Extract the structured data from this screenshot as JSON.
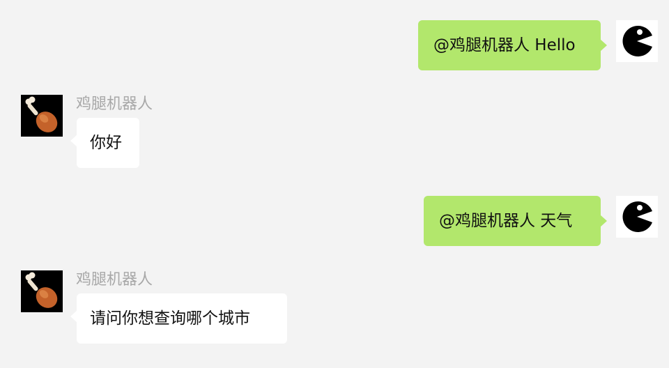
{
  "messages": [
    {
      "direction": "out",
      "text": "@鸡腿机器人 Hello"
    },
    {
      "direction": "in",
      "sender": "鸡腿机器人",
      "text": "你好"
    },
    {
      "direction": "out",
      "text": "@鸡腿机器人 天气"
    },
    {
      "direction": "in",
      "sender": "鸡腿机器人",
      "text": "请问你想查询哪个城市"
    }
  ],
  "icons": {
    "self_avatar": "pacman-icon",
    "bot_avatar": "chicken-drumstick-icon"
  },
  "colors": {
    "background": "#f3f3f3",
    "outgoing_bubble": "#b2e76c",
    "incoming_bubble": "#ffffff",
    "sender_name": "#a8a8a8"
  }
}
